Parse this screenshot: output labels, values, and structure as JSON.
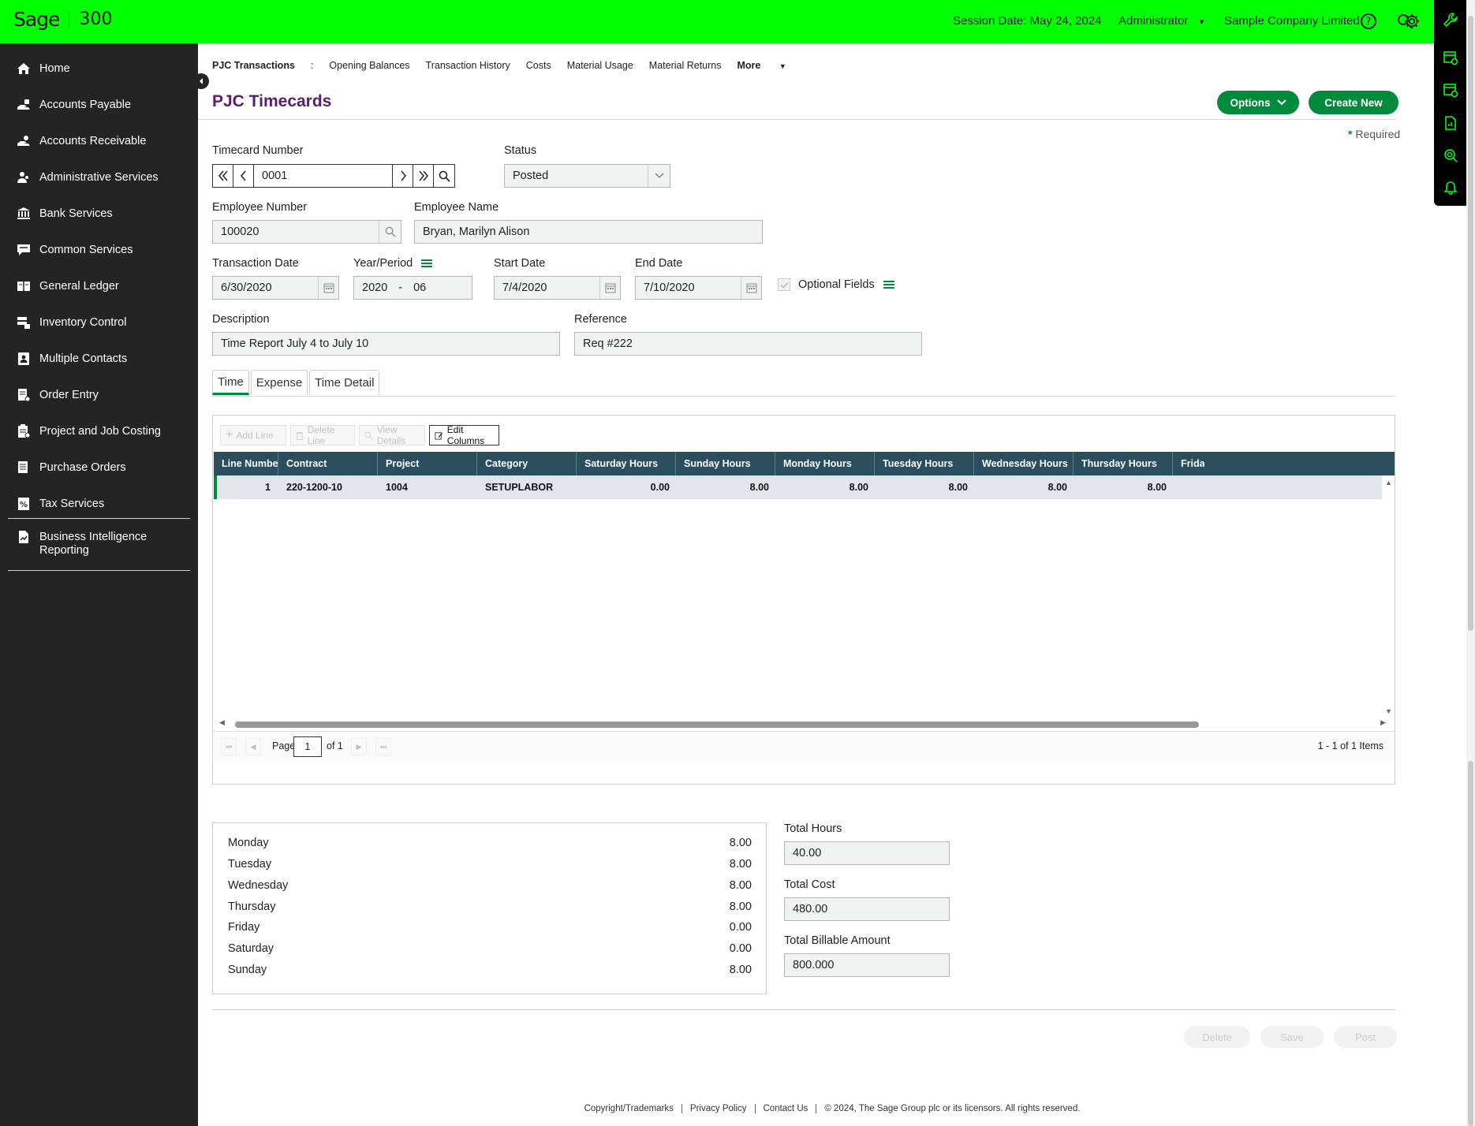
{
  "topbar": {
    "brand": "Sage",
    "version": "300",
    "session_date": "Session Date:  May 24, 2024",
    "user": "Administrator",
    "company": "Sample Company Limited"
  },
  "sidebar": {
    "items": [
      {
        "label": "Home",
        "icon": "home-icon"
      },
      {
        "label": "Accounts Payable",
        "icon": "hand-money-icon"
      },
      {
        "label": "Accounts Receivable",
        "icon": "hand-receive-icon"
      },
      {
        "label": "Administrative Services",
        "icon": "people-icon"
      },
      {
        "label": "Bank Services",
        "icon": "bank-icon"
      },
      {
        "label": "Common Services",
        "icon": "chat-icon"
      },
      {
        "label": "General Ledger",
        "icon": "ledger-icon"
      },
      {
        "label": "Inventory Control",
        "icon": "inventory-icon"
      },
      {
        "label": "Multiple Contacts",
        "icon": "contact-icon"
      },
      {
        "label": "Order Entry",
        "icon": "order-icon"
      },
      {
        "label": "Project and Job Costing",
        "icon": "project-icon"
      },
      {
        "label": "Purchase Orders",
        "icon": "purchase-icon"
      },
      {
        "label": "Tax Services",
        "icon": "tax-icon"
      }
    ],
    "bi_label_1": "Business Intelligence",
    "bi_label_2": "Reporting"
  },
  "subnav": {
    "items": [
      "PJC Transactions",
      ":",
      "Opening Balances",
      "Transaction History",
      "Costs",
      "Material Usage",
      "Material Returns",
      "More"
    ]
  },
  "page": {
    "title": "PJC Timecards",
    "options_label": "Options",
    "create_label": "Create New",
    "required_mark": "*",
    "required_label": "Required"
  },
  "form": {
    "timecard_number_label": "Timecard Number",
    "timecard_number": "0001",
    "status_label": "Status",
    "status": "Posted",
    "employee_number_label": "Employee Number",
    "employee_number": "100020",
    "employee_name_label": "Employee Name",
    "employee_name": "Bryan, Marilyn Alison",
    "transaction_date_label": "Transaction Date",
    "transaction_date": "6/30/2020",
    "year_period_label": "Year/Period",
    "year": "2020",
    "period_sep": "-",
    "period": "06",
    "start_date_label": "Start Date",
    "start_date": "7/4/2020",
    "end_date_label": "End Date",
    "end_date": "7/10/2020",
    "optional_fields_label": "Optional Fields",
    "description_label": "Description",
    "description": "Time Report July 4 to July 10",
    "reference_label": "Reference",
    "reference": "Req #222"
  },
  "tabs": [
    "Time",
    "Expense",
    "Time Detail"
  ],
  "grid": {
    "toolbar": {
      "add": "Add Line",
      "delete": "Delete Line",
      "view": "View Details",
      "edit": "Edit Columns"
    },
    "columns": [
      "Line Number",
      "Contract",
      "Project",
      "Category",
      "Saturday Hours",
      "Sunday Hours",
      "Monday Hours",
      "Tuesday Hours",
      "Wednesday Hours",
      "Thursday Hours",
      "Frida"
    ],
    "row": [
      "1",
      "220-1200-10",
      "1004",
      "SETUPLABOR",
      "0.00",
      "8.00",
      "8.00",
      "8.00",
      "8.00",
      "8.00"
    ],
    "pager": {
      "page_label": "Page",
      "page": "1",
      "of": "of 1",
      "items": "1 - 1 of 1 Items"
    }
  },
  "summary": {
    "days": [
      {
        "day": "Monday",
        "hours": "8.00"
      },
      {
        "day": "Tuesday",
        "hours": "8.00"
      },
      {
        "day": "Wednesday",
        "hours": "8.00"
      },
      {
        "day": "Thursday",
        "hours": "8.00"
      },
      {
        "day": "Friday",
        "hours": "0.00"
      },
      {
        "day": "Saturday",
        "hours": "0.00"
      },
      {
        "day": "Sunday",
        "hours": "8.00"
      }
    ],
    "total_hours_label": "Total Hours",
    "total_hours": "40.00",
    "total_cost_label": "Total Cost",
    "total_cost": "480.00",
    "total_billable_label": "Total Billable Amount",
    "total_billable": "800.000"
  },
  "actions": {
    "delete": "Delete",
    "save": "Save",
    "post": "Post"
  },
  "footer": {
    "copyright": "Copyright/Trademarks",
    "privacy": "Privacy Policy",
    "contact": "Contact Us",
    "notice": "© 2024, The Sage Group plc or its licensors. All rights reserved."
  },
  "colors": {
    "accent": "#008a3c",
    "topbar": "#00ff00",
    "sidebar": "#242424",
    "grid_header": "#2a4e5e",
    "title": "#5a1e6e"
  }
}
